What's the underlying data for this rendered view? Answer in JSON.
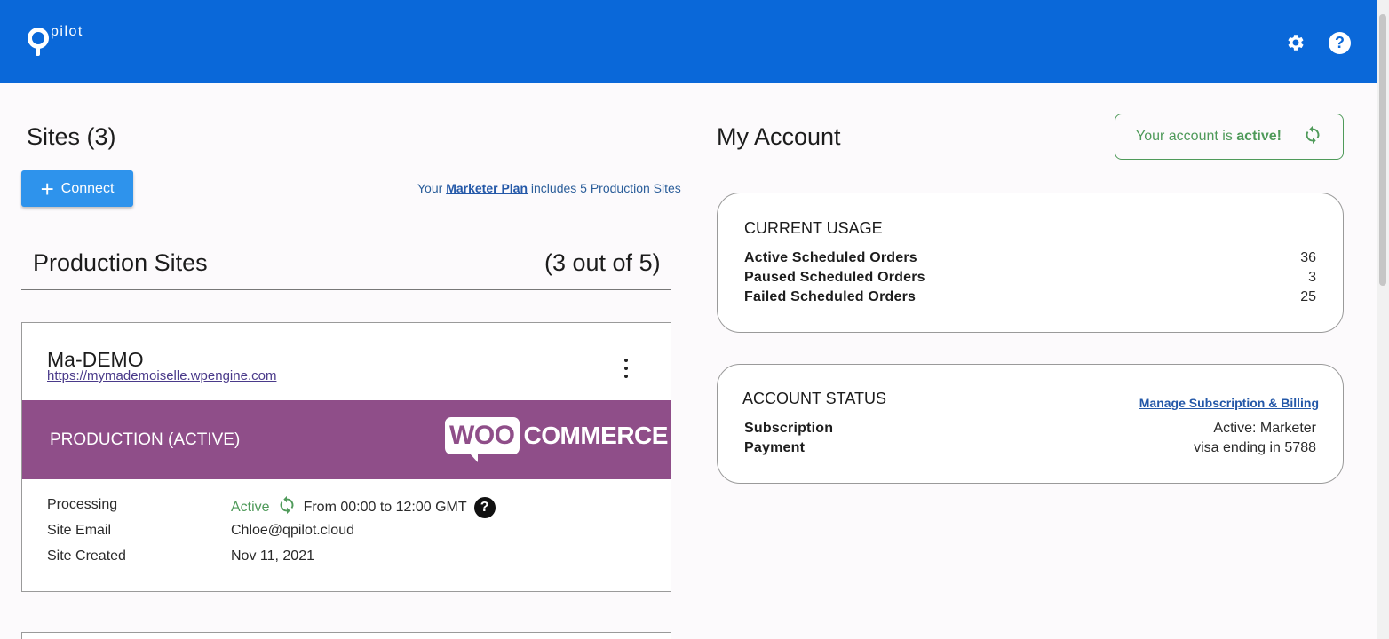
{
  "header": {
    "logo_text": "pilot",
    "settings_icon": "gear-icon",
    "help_icon": "help-icon",
    "help_glyph": "?"
  },
  "sites": {
    "title": "Sites (3)",
    "connect_label": "Connect",
    "plan_prefix": "Your",
    "plan_link": "Marketer Plan",
    "plan_suffix": "includes 5 Production Sites",
    "production_heading": "Production Sites",
    "production_count": "(3 out of 5)",
    "card": {
      "name": "Ma-DEMO",
      "url": "https://mymademoiselle.wpengine.com",
      "banner_label": "PRODUCTION (ACTIVE)",
      "platform_woo": "WOO",
      "platform_commerce": "COMMERCE",
      "processing_label": "Processing",
      "processing_status": "Active",
      "processing_window": "From 00:00 to 12:00 GMT",
      "email_label": "Site Email",
      "email_value": "Chloe@qpilot.cloud",
      "created_label": "Site Created",
      "created_value": "Nov 11, 2021"
    }
  },
  "account": {
    "title": "My Account",
    "status_prefix": "Your account is",
    "status_value": "active!",
    "usage": {
      "title": "CURRENT USAGE",
      "rows": [
        {
          "label": "Active Scheduled Orders",
          "value": "36"
        },
        {
          "label": "Paused Scheduled Orders",
          "value": "3"
        },
        {
          "label": "Failed Scheduled Orders",
          "value": "25"
        }
      ]
    },
    "status": {
      "title": "ACCOUNT STATUS",
      "manage_link": "Manage Subscription & Billing",
      "subscription_label": "Subscription",
      "subscription_value": "Active: Marketer",
      "payment_label": "Payment",
      "payment_value": "visa ending in 5788"
    }
  },
  "colors": {
    "topbar": "#0a68d9",
    "woo_purple": "#8f4e89",
    "active_green": "#4f9a5a",
    "connect_blue": "#2e93ec"
  }
}
